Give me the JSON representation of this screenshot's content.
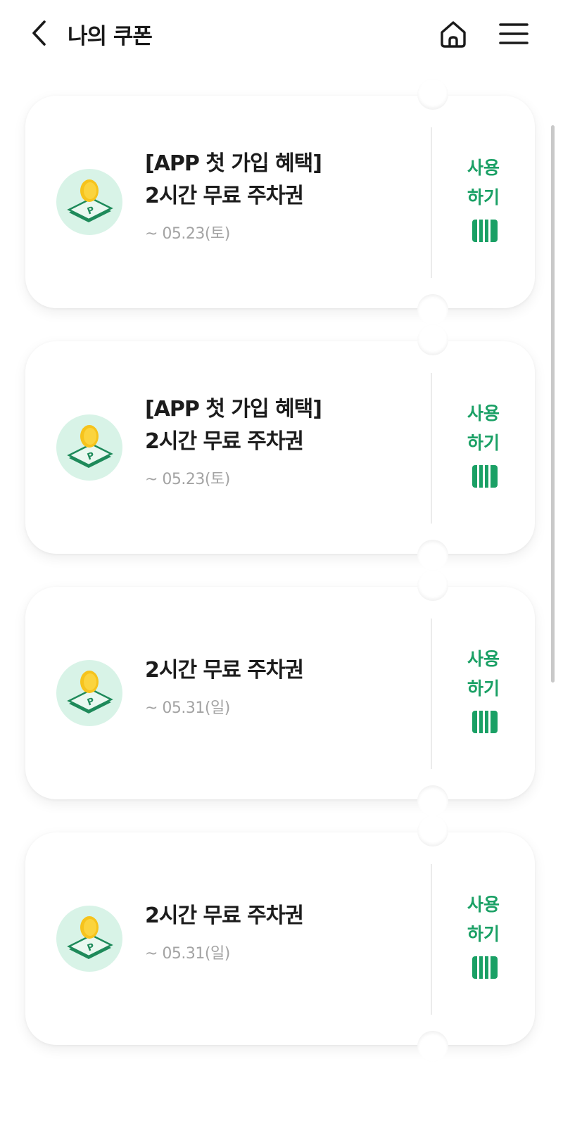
{
  "header": {
    "title": "나의 쿠폰",
    "back_icon": "chevron-left-icon",
    "home_icon": "home-icon",
    "menu_icon": "hamburger-menu-icon"
  },
  "theme": {
    "accent": "#1aa065",
    "icon_bg": "#d8f3e7",
    "coin": "#f6c31c",
    "date_text": "#a3a3a3"
  },
  "coupons": [
    {
      "title_lines": [
        "[APP 첫 가입 혜택]",
        "2시간 무료 주차권"
      ],
      "expiry": "~ 05.23(토)",
      "use_label_1": "사용",
      "use_label_2": "하기",
      "icon": "parking-coin-icon"
    },
    {
      "title_lines": [
        "[APP 첫 가입 혜택]",
        "2시간 무료 주차권"
      ],
      "expiry": "~ 05.23(토)",
      "use_label_1": "사용",
      "use_label_2": "하기",
      "icon": "parking-coin-icon"
    },
    {
      "title_lines": [
        "2시간 무료 주차권"
      ],
      "expiry": "~ 05.31(일)",
      "use_label_1": "사용",
      "use_label_2": "하기",
      "icon": "parking-coin-icon"
    },
    {
      "title_lines": [
        "2시간 무료 주차권"
      ],
      "expiry": "~ 05.31(일)",
      "use_label_1": "사용",
      "use_label_2": "하기",
      "icon": "parking-coin-icon"
    }
  ]
}
